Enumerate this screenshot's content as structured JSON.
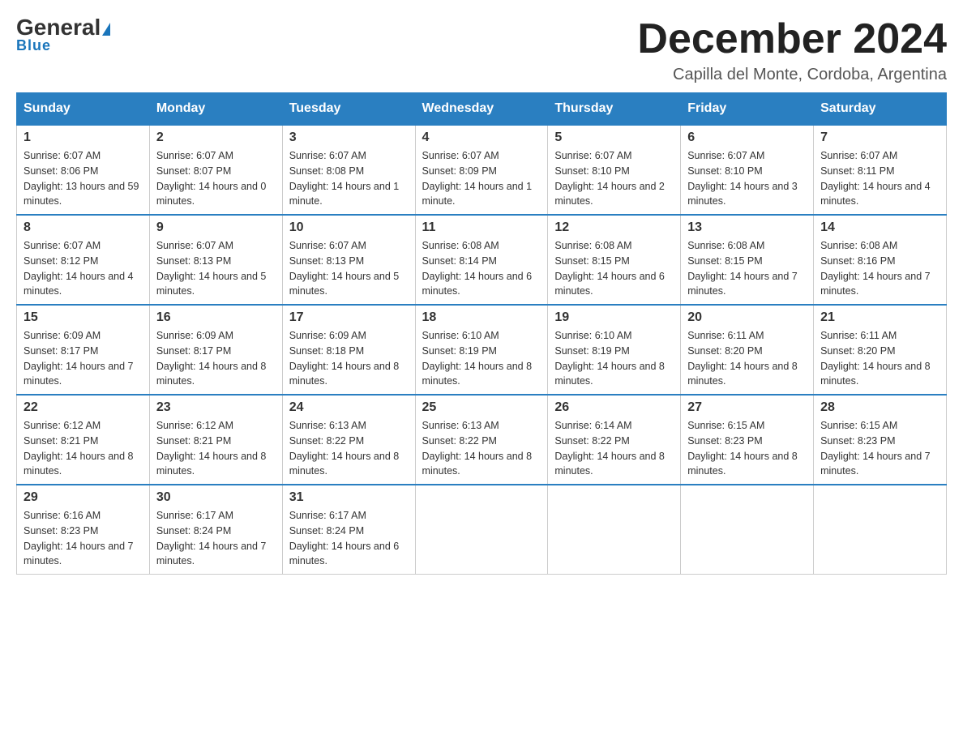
{
  "logo": {
    "general": "General",
    "blue": "Blue"
  },
  "title": "December 2024",
  "subtitle": "Capilla del Monte, Cordoba, Argentina",
  "days_of_week": [
    "Sunday",
    "Monday",
    "Tuesday",
    "Wednesday",
    "Thursday",
    "Friday",
    "Saturday"
  ],
  "weeks": [
    [
      {
        "day": "1",
        "sunrise": "6:07 AM",
        "sunset": "8:06 PM",
        "daylight": "13 hours and 59 minutes."
      },
      {
        "day": "2",
        "sunrise": "6:07 AM",
        "sunset": "8:07 PM",
        "daylight": "14 hours and 0 minutes."
      },
      {
        "day": "3",
        "sunrise": "6:07 AM",
        "sunset": "8:08 PM",
        "daylight": "14 hours and 1 minute."
      },
      {
        "day": "4",
        "sunrise": "6:07 AM",
        "sunset": "8:09 PM",
        "daylight": "14 hours and 1 minute."
      },
      {
        "day": "5",
        "sunrise": "6:07 AM",
        "sunset": "8:10 PM",
        "daylight": "14 hours and 2 minutes."
      },
      {
        "day": "6",
        "sunrise": "6:07 AM",
        "sunset": "8:10 PM",
        "daylight": "14 hours and 3 minutes."
      },
      {
        "day": "7",
        "sunrise": "6:07 AM",
        "sunset": "8:11 PM",
        "daylight": "14 hours and 4 minutes."
      }
    ],
    [
      {
        "day": "8",
        "sunrise": "6:07 AM",
        "sunset": "8:12 PM",
        "daylight": "14 hours and 4 minutes."
      },
      {
        "day": "9",
        "sunrise": "6:07 AM",
        "sunset": "8:13 PM",
        "daylight": "14 hours and 5 minutes."
      },
      {
        "day": "10",
        "sunrise": "6:07 AM",
        "sunset": "8:13 PM",
        "daylight": "14 hours and 5 minutes."
      },
      {
        "day": "11",
        "sunrise": "6:08 AM",
        "sunset": "8:14 PM",
        "daylight": "14 hours and 6 minutes."
      },
      {
        "day": "12",
        "sunrise": "6:08 AM",
        "sunset": "8:15 PM",
        "daylight": "14 hours and 6 minutes."
      },
      {
        "day": "13",
        "sunrise": "6:08 AM",
        "sunset": "8:15 PM",
        "daylight": "14 hours and 7 minutes."
      },
      {
        "day": "14",
        "sunrise": "6:08 AM",
        "sunset": "8:16 PM",
        "daylight": "14 hours and 7 minutes."
      }
    ],
    [
      {
        "day": "15",
        "sunrise": "6:09 AM",
        "sunset": "8:17 PM",
        "daylight": "14 hours and 7 minutes."
      },
      {
        "day": "16",
        "sunrise": "6:09 AM",
        "sunset": "8:17 PM",
        "daylight": "14 hours and 8 minutes."
      },
      {
        "day": "17",
        "sunrise": "6:09 AM",
        "sunset": "8:18 PM",
        "daylight": "14 hours and 8 minutes."
      },
      {
        "day": "18",
        "sunrise": "6:10 AM",
        "sunset": "8:19 PM",
        "daylight": "14 hours and 8 minutes."
      },
      {
        "day": "19",
        "sunrise": "6:10 AM",
        "sunset": "8:19 PM",
        "daylight": "14 hours and 8 minutes."
      },
      {
        "day": "20",
        "sunrise": "6:11 AM",
        "sunset": "8:20 PM",
        "daylight": "14 hours and 8 minutes."
      },
      {
        "day": "21",
        "sunrise": "6:11 AM",
        "sunset": "8:20 PM",
        "daylight": "14 hours and 8 minutes."
      }
    ],
    [
      {
        "day": "22",
        "sunrise": "6:12 AM",
        "sunset": "8:21 PM",
        "daylight": "14 hours and 8 minutes."
      },
      {
        "day": "23",
        "sunrise": "6:12 AM",
        "sunset": "8:21 PM",
        "daylight": "14 hours and 8 minutes."
      },
      {
        "day": "24",
        "sunrise": "6:13 AM",
        "sunset": "8:22 PM",
        "daylight": "14 hours and 8 minutes."
      },
      {
        "day": "25",
        "sunrise": "6:13 AM",
        "sunset": "8:22 PM",
        "daylight": "14 hours and 8 minutes."
      },
      {
        "day": "26",
        "sunrise": "6:14 AM",
        "sunset": "8:22 PM",
        "daylight": "14 hours and 8 minutes."
      },
      {
        "day": "27",
        "sunrise": "6:15 AM",
        "sunset": "8:23 PM",
        "daylight": "14 hours and 8 minutes."
      },
      {
        "day": "28",
        "sunrise": "6:15 AM",
        "sunset": "8:23 PM",
        "daylight": "14 hours and 7 minutes."
      }
    ],
    [
      {
        "day": "29",
        "sunrise": "6:16 AM",
        "sunset": "8:23 PM",
        "daylight": "14 hours and 7 minutes."
      },
      {
        "day": "30",
        "sunrise": "6:17 AM",
        "sunset": "8:24 PM",
        "daylight": "14 hours and 7 minutes."
      },
      {
        "day": "31",
        "sunrise": "6:17 AM",
        "sunset": "8:24 PM",
        "daylight": "14 hours and 6 minutes."
      },
      null,
      null,
      null,
      null
    ]
  ]
}
